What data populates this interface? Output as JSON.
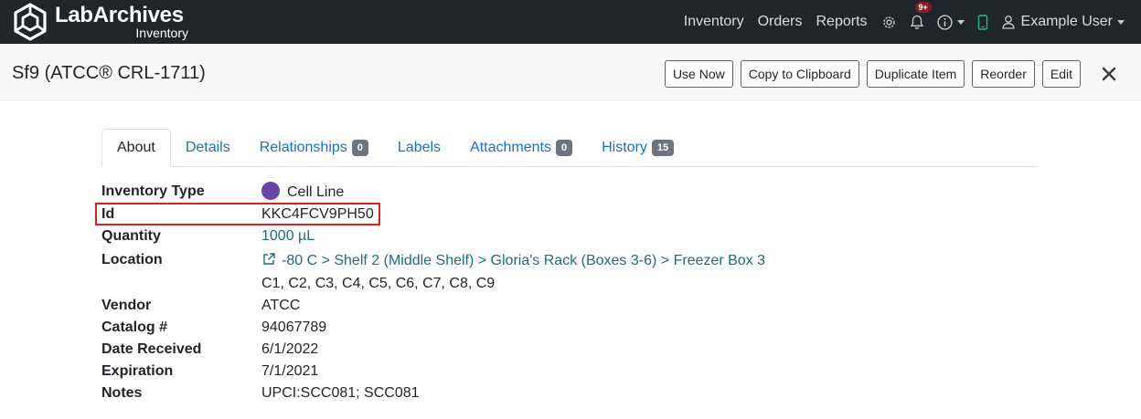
{
  "brand": {
    "name": "LabArchives",
    "sub": "Inventory"
  },
  "nav": {
    "links": [
      "Inventory",
      "Orders",
      "Reports"
    ],
    "notifications_badge": "9+",
    "user": "Example User"
  },
  "header": {
    "title": "Sf9 (ATCC® CRL-1711)",
    "actions": [
      "Use Now",
      "Copy to Clipboard",
      "Duplicate Item",
      "Reorder",
      "Edit"
    ]
  },
  "tabs": [
    {
      "label": "About",
      "count": null,
      "active": true
    },
    {
      "label": "Details",
      "count": null
    },
    {
      "label": "Relationships",
      "count": "0"
    },
    {
      "label": "Labels",
      "count": null
    },
    {
      "label": "Attachments",
      "count": "0"
    },
    {
      "label": "History",
      "count": "15"
    }
  ],
  "details": {
    "inventory_type_label": "Inventory Type",
    "inventory_type": "Cell Line",
    "inventory_type_color": "#6a44a9",
    "id_label": "Id",
    "id": "KKC4FCV9PH50",
    "quantity_label": "Quantity",
    "quantity": "1000 µL",
    "location_label": "Location",
    "location": "-80 C > Shelf 2 (Middle Shelf) > Gloria's Rack (Boxes 3-6) > Freezer Box 3",
    "location_positions": "C1, C2, C3, C4, C5, C6, C7, C8, C9",
    "vendor_label": "Vendor",
    "vendor": "ATCC",
    "catalog_label": "Catalog #",
    "catalog": "94067789",
    "date_received_label": "Date Received",
    "date_received": "6/1/2022",
    "expiration_label": "Expiration",
    "expiration": "7/1/2021",
    "notes_label": "Notes",
    "notes": "UPCI:SCC081; SCC081"
  },
  "colors": {
    "navbar": "#1f252b",
    "link": "#1a6fc9",
    "location_link": "#1c6e7a",
    "highlight": "#d9221f"
  }
}
